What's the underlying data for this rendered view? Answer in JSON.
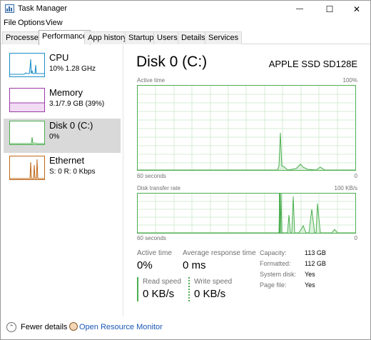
{
  "window": {
    "title": "Task Manager",
    "minimize": "—",
    "maximize": "☐",
    "close": "✕"
  },
  "menu": [
    "File",
    "Options",
    "View"
  ],
  "tabs": [
    "Processes",
    "Performance",
    "App history",
    "Startup",
    "Users",
    "Details",
    "Services"
  ],
  "active_tab": "Performance",
  "sidebar": {
    "items": [
      {
        "title": "CPU",
        "subtitle": "10%  1.28 GHz",
        "color": "#1a8cc7",
        "icon": "cpu-graph-icon"
      },
      {
        "title": "Memory",
        "subtitle": "3.1/7.9 GB (39%)",
        "color": "#9b39a8",
        "icon": "memory-graph-icon"
      },
      {
        "title": "Disk 0 (C:)",
        "subtitle": "0%",
        "color": "#4caf50",
        "icon": "disk-graph-icon"
      },
      {
        "title": "Ethernet",
        "subtitle": "S: 0 R: 0 Kbps",
        "color": "#c0691b",
        "icon": "ethernet-graph-icon"
      }
    ],
    "selected": "Disk 0 (C:)"
  },
  "main": {
    "title": "Disk 0 (C:)",
    "model": "APPLE SSD SD128E",
    "active_chart": {
      "label": "Active time",
      "max_label": "100%",
      "time_label": "60 seconds",
      "zero_label": "0"
    },
    "transfer_chart": {
      "label": "Disk transfer rate",
      "max_label": "100 KB/s",
      "time_label": "60 seconds",
      "zero_label": "0"
    },
    "stats": {
      "active_time_label": "Active time",
      "active_time_value": "0%",
      "avg_response_label": "Average response time",
      "avg_response_value": "0 ms",
      "read_speed_label": "Read speed",
      "read_speed_value": "0 KB/s",
      "write_speed_label": "Write speed",
      "write_speed_value": "0 KB/s"
    },
    "details": {
      "capacity_label": "Capacity:",
      "capacity_value": "113 GB",
      "formatted_label": "Formatted:",
      "formatted_value": "112 GB",
      "system_disk_label": "System disk:",
      "system_disk_value": "Yes",
      "page_file_label": "Page file:",
      "page_file_value": "Yes"
    }
  },
  "footer": {
    "fewer_details": "Fewer details",
    "open_resource_monitor": "Open Resource Monitor"
  },
  "colors": {
    "disk_green": "#4caf50",
    "grid": "#d4ecd4",
    "link": "#1a56b6"
  }
}
